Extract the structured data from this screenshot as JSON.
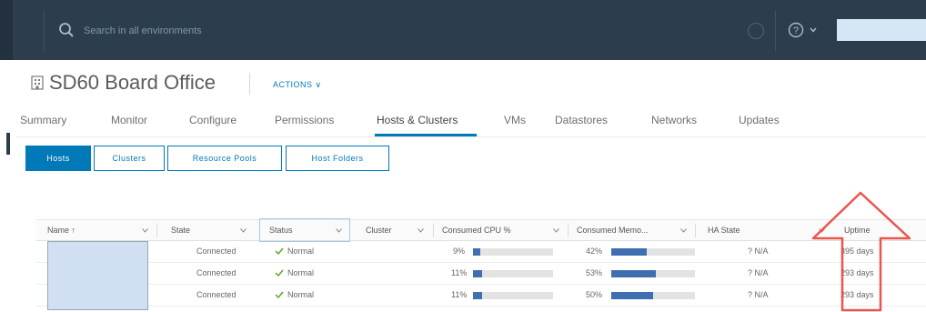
{
  "header": {
    "search_placeholder": "Search in all environments"
  },
  "page": {
    "title": "SD60 Board Office",
    "actions_label": "ACTIONS ∨"
  },
  "tabs": [
    {
      "label": "Summary"
    },
    {
      "label": "Monitor"
    },
    {
      "label": "Configure"
    },
    {
      "label": "Permissions"
    },
    {
      "label": "Hosts & Clusters"
    },
    {
      "label": "VMs"
    },
    {
      "label": "Datastores"
    },
    {
      "label": "Networks"
    },
    {
      "label": "Updates"
    }
  ],
  "active_tab": "Hosts & Clusters",
  "subtabs": [
    {
      "label": "Hosts"
    },
    {
      "label": "Clusters"
    },
    {
      "label": "Resource Pools"
    },
    {
      "label": "Host Folders"
    }
  ],
  "active_subtab": "Hosts",
  "grid": {
    "columns": [
      "Name ↑",
      "State",
      "Status",
      "Cluster",
      "Consumed CPU %",
      "Consumed Memo...",
      "HA State",
      "Uptime"
    ],
    "rows": [
      {
        "state": "Connected",
        "status": "Normal",
        "cpu": "9%",
        "cpu_level": 9,
        "mem": "42%",
        "mem_level": 42,
        "ha": "? N/A",
        "uptime": "395 days"
      },
      {
        "state": "Connected",
        "status": "Normal",
        "cpu": "11%",
        "cpu_level": 11,
        "mem": "53%",
        "mem_level": 53,
        "ha": "? N/A",
        "uptime": "293 days"
      },
      {
        "state": "Connected",
        "status": "Normal",
        "cpu": "11%",
        "cpu_level": 11,
        "mem": "50%",
        "mem_level": 50,
        "ha": "? N/A",
        "uptime": "293 days"
      }
    ]
  },
  "colors": {
    "header_bg": "#2c3e4d",
    "accent": "#0079b8",
    "bar_fill": "#3f6fb0",
    "status_ok": "#5aa220",
    "annotation_arrow": "#e8564f"
  },
  "icons": {
    "search": "search-icon",
    "help": "help-icon",
    "datacenter": "datacenter-icon",
    "status_ok": "check-icon"
  }
}
